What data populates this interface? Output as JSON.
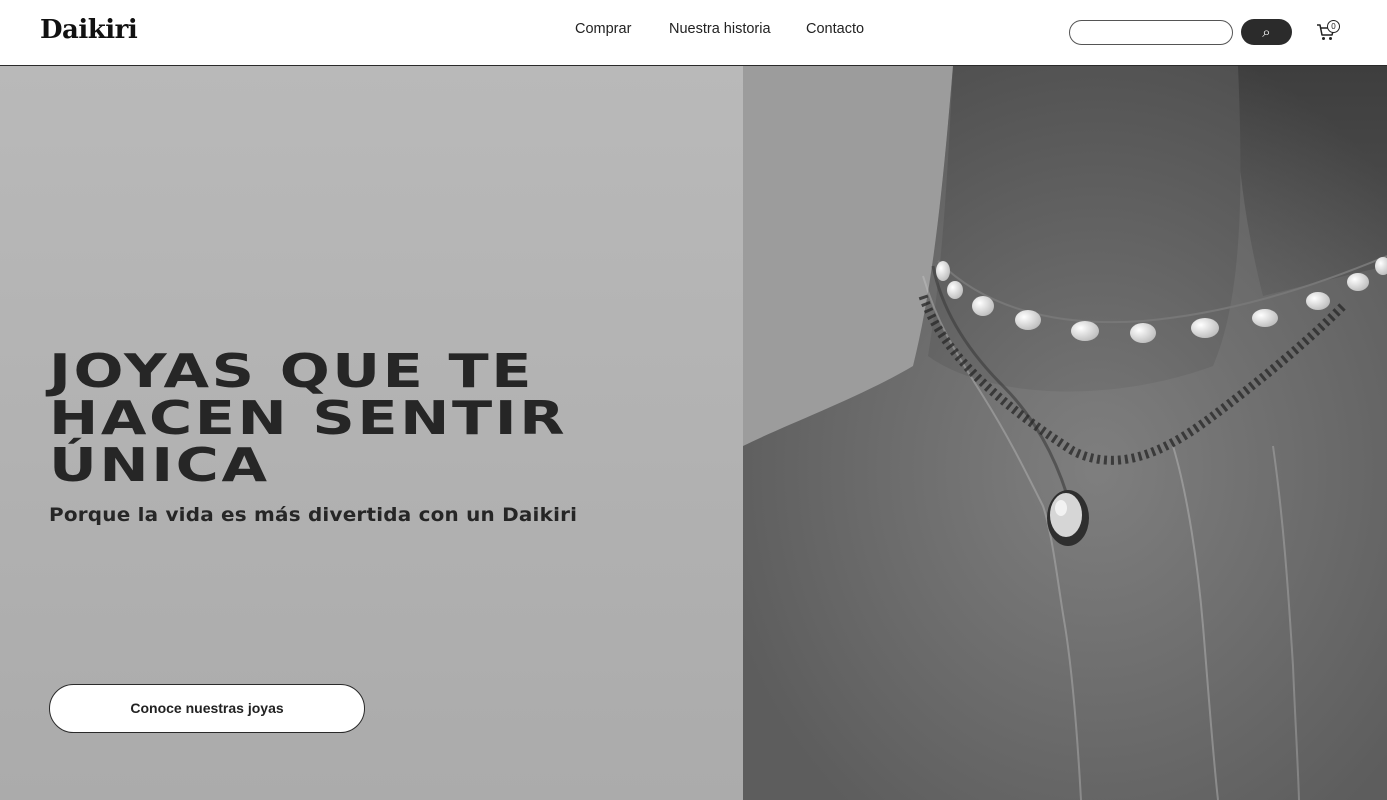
{
  "header": {
    "logo": "Daikiri",
    "nav": [
      "Comprar",
      "Nuestra historia",
      "Contacto"
    ],
    "search": {
      "placeholder": "",
      "button_icon": "⌕"
    },
    "cart": {
      "count": "0"
    }
  },
  "hero": {
    "title": "JOYAS QUE TE\nHACEN SENTIR\nÚNICA",
    "subtitle": "Porque la vida es más divertida con un Daikiri",
    "cta": "Conoce nuestras joyas"
  },
  "colors": {
    "left_panel": "#b3b3b3",
    "text": "#262626",
    "search_button": "#2b2b2b"
  },
  "icons": [
    "search-icon",
    "cart-icon"
  ]
}
